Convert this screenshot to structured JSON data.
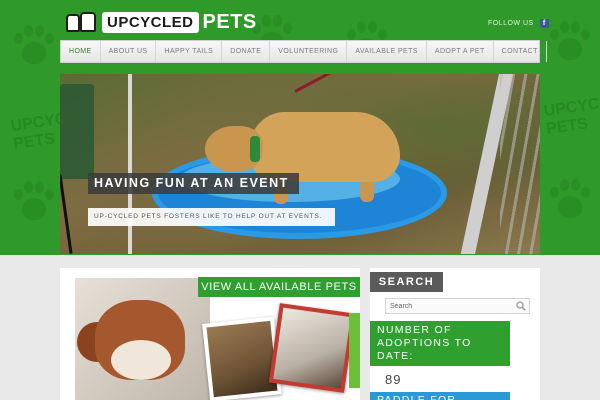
{
  "brand": {
    "logo_left": "UPCYCLED",
    "logo_right": "PETS",
    "follow_label": "FOLLOW US",
    "side_watermark": "UPCYCLED PETS"
  },
  "nav": {
    "items": [
      {
        "label": "HOME",
        "active": true
      },
      {
        "label": "ABOUT US"
      },
      {
        "label": "HAPPY TAILS"
      },
      {
        "label": "DONATE"
      },
      {
        "label": "VOLUNTEERING"
      },
      {
        "label": "AVAILABLE PETS"
      },
      {
        "label": "ADOPT A PET"
      },
      {
        "label": "CONTACT"
      }
    ]
  },
  "hero": {
    "caption_title": "HAVING FUN AT AN EVENT",
    "caption_text": "UP-CYCLED PETS FOSTERS LIKE TO HELP OUT AT EVENTS."
  },
  "featured": {
    "view_all_label": "VIEW ALL AVAILABLE PETS"
  },
  "sidebar": {
    "search_heading": "SEARCH",
    "search_placeholder": "Search",
    "adoptions_label": "NUMBER OF ADOPTIONS TO DATE:",
    "adoptions_count": "89",
    "paddle_label": "PADDLE FOR"
  },
  "colors": {
    "brand_green": "#2f9a2a",
    "accent_green": "#2fa030",
    "accent_blue": "#2a9ad6",
    "facebook_blue": "#3b5998"
  }
}
